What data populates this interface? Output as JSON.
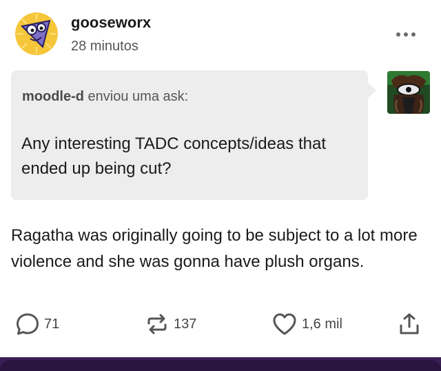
{
  "post": {
    "author": "gooseworx",
    "timestamp": "28 minutos",
    "ask": {
      "asker": "moodle-d",
      "action_text": " enviou uma ask:",
      "question": "Any interesting TADC concepts/ideas that ended up being cut?"
    },
    "answer": "Ragatha was originally going to be subject to a lot more violence and she was gonna have plush organs.",
    "actions": {
      "replies": "71",
      "reblogs": "137",
      "likes": "1,6 mil"
    }
  },
  "icons": {
    "more": "more-horizontal-icon",
    "reply": "comment-bubble-icon",
    "reblog": "reblog-arrows-icon",
    "like": "heart-outline-icon",
    "share": "share-upload-icon"
  },
  "colors": {
    "ask_background": "#ededed",
    "icon": "#555555",
    "bottom_bar": "#3a1f55"
  }
}
